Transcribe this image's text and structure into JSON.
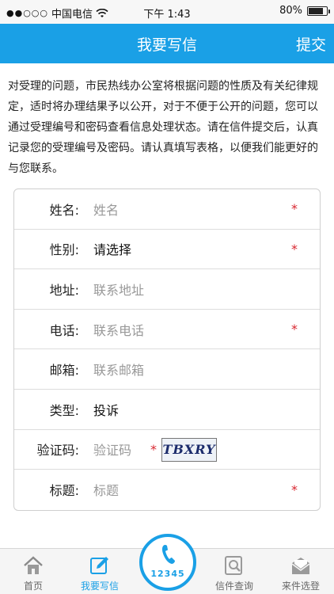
{
  "status_bar": {
    "signal": "●●○○○",
    "carrier": "中国电信",
    "time": "下午 1:43",
    "battery": "80%",
    "battery_level": 0.8
  },
  "nav": {
    "title": "我要写信",
    "submit_label": "提交"
  },
  "intro": "对受理的问题，市民热线办公室将根据问题的性质及有关纪律规定，适时将办理结果予以公开，对于不便于公开的问题，您可以通过受理编号和密码查看信息处理状态。请在信件提交后，认真记录您的受理编号及密码。请认真填写表格，以便我们能更好的与您联系。",
  "form": {
    "required_mark": "*",
    "rows": [
      {
        "label": "姓名:",
        "placeholder": "姓名",
        "value": ""
      },
      {
        "label": "性别:",
        "placeholder": "",
        "value": "请选择"
      },
      {
        "label": "地址:",
        "placeholder": "联系地址",
        "value": ""
      },
      {
        "label": "电话:",
        "placeholder": "联系电话",
        "value": ""
      },
      {
        "label": "邮箱:",
        "placeholder": "联系邮箱",
        "value": ""
      },
      {
        "label": "类型:",
        "placeholder": "",
        "value": "投诉"
      },
      {
        "label": "验证码:",
        "placeholder": "验证码",
        "value": ""
      },
      {
        "label": "标题:",
        "placeholder": "标题",
        "value": ""
      }
    ],
    "captcha_text": "TBXRY"
  },
  "tabs": {
    "home": "首页",
    "write": "我要写信",
    "call_number": "12345",
    "query": "信件查询",
    "showcase": "来件选登"
  },
  "colors": {
    "brand": "#1aa0e6",
    "required": "#d8262f"
  }
}
